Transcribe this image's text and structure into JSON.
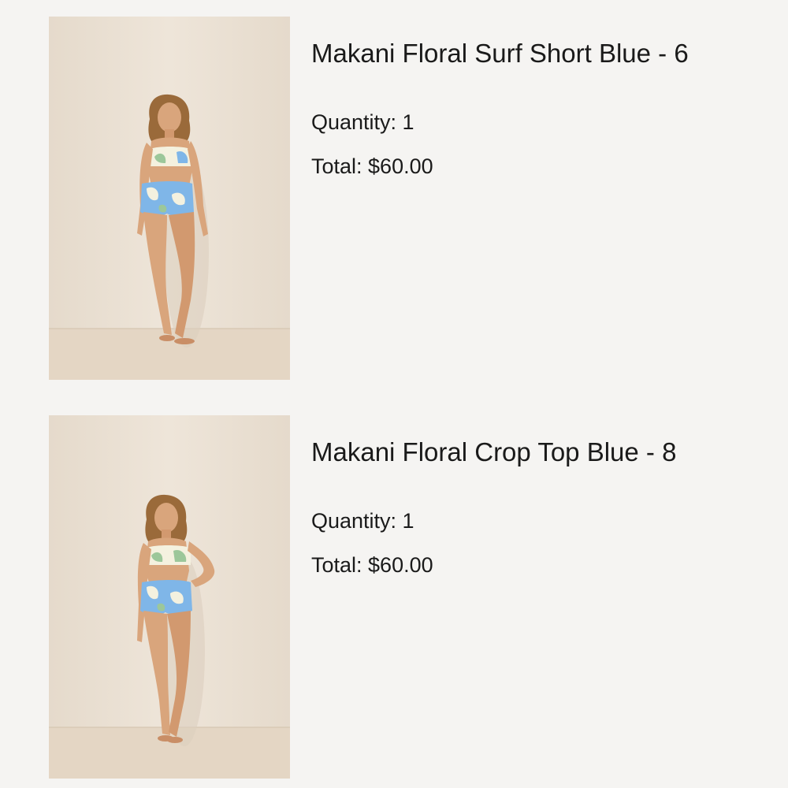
{
  "order_items": [
    {
      "title": "Makani Floral Surf Short Blue - 6",
      "quantity_text": "Quantity: 1",
      "total_text": "Total: $60.00",
      "image_subject": "model-wearing-floral-surf-short"
    },
    {
      "title": "Makani Floral Crop Top Blue - 8",
      "quantity_text": "Quantity: 1",
      "total_text": "Total: $60.00",
      "image_subject": "model-wearing-floral-crop-top"
    }
  ],
  "colors": {
    "page_background": "#f5f4f2",
    "text": "#1a1a1a",
    "photo_wall": "#ece2d5",
    "photo_floor": "#e4d6c4",
    "swim_blue": "#7fb6e8",
    "swim_cream": "#f4f1df",
    "leaf_green": "#9cc79a",
    "skin": "#d9a57c",
    "hair": "#9a6a3a"
  }
}
